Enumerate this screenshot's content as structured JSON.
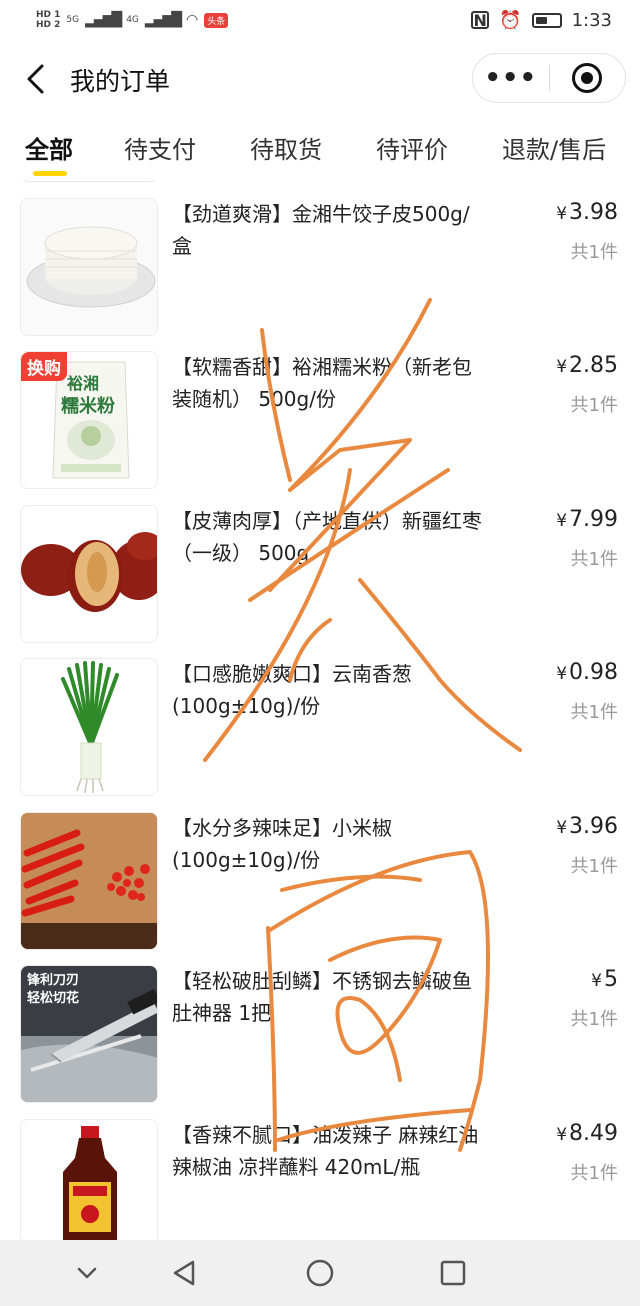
{
  "status_bar": {
    "hd1": "HD 1",
    "hd2": "HD 2",
    "signal1": "5G",
    "signal2": "4G",
    "toutiao": "头条",
    "time": "1:33",
    "battery_level": 0.5
  },
  "nav": {
    "title": "我的订单",
    "more_label": "•••"
  },
  "tabs": [
    {
      "label": "全部",
      "active": true
    },
    {
      "label": "待支付",
      "active": false
    },
    {
      "label": "待取货",
      "active": false
    },
    {
      "label": "待评价",
      "active": false
    },
    {
      "label": "退款/售后",
      "active": false
    }
  ],
  "items": [
    {
      "title": "【劲道爽滑】金湘牛饺子皮500g/盒",
      "price": "3.98",
      "currency": "¥",
      "qty": "共1件",
      "image": "dumpling-wrappers"
    },
    {
      "badge": "换购",
      "title": "【软糯香甜】裕湘糯米粉（新老包装随机） 500g/份",
      "price": "2.85",
      "currency": "¥",
      "qty": "共1件",
      "image": "glutinous-rice-flour-bag",
      "pack_text": "裕湘",
      "pack_sub": "糯米粉"
    },
    {
      "title": "【皮薄肉厚】（产地直供）新疆红枣（一级） 500g",
      "price": "7.99",
      "currency": "¥",
      "qty": "共1件",
      "image": "red-dates"
    },
    {
      "title": "【口感脆嫩爽口】云南香葱(100g±10g)/份",
      "price": "0.98",
      "currency": "¥",
      "qty": "共1件",
      "image": "green-onions"
    },
    {
      "title": "【水分多辣味足】小米椒(100g±10g)/份",
      "price": "3.96",
      "currency": "¥",
      "qty": "共1件",
      "image": "red-chili-peppers"
    },
    {
      "title": "【轻松破肚刮鳞】不锈钢去鳞破鱼肚神器 1把",
      "price": "5",
      "currency": "¥",
      "qty": "共1件",
      "image": "fish-scaler",
      "overlay_line1": "锋利刀刃",
      "overlay_line2": "轻松切花"
    },
    {
      "title": "【香辣不腻口】油泼辣子 麻辣红油辣椒油 凉拌蘸料 420mL/瓶",
      "price": "8.49",
      "currency": "¥",
      "qty": "共1件",
      "image": "chili-oil-bottle"
    }
  ],
  "colors": {
    "accent": "#ffd400",
    "badge": "#f04033",
    "scribble": "#e8893f",
    "muted": "#999999"
  }
}
